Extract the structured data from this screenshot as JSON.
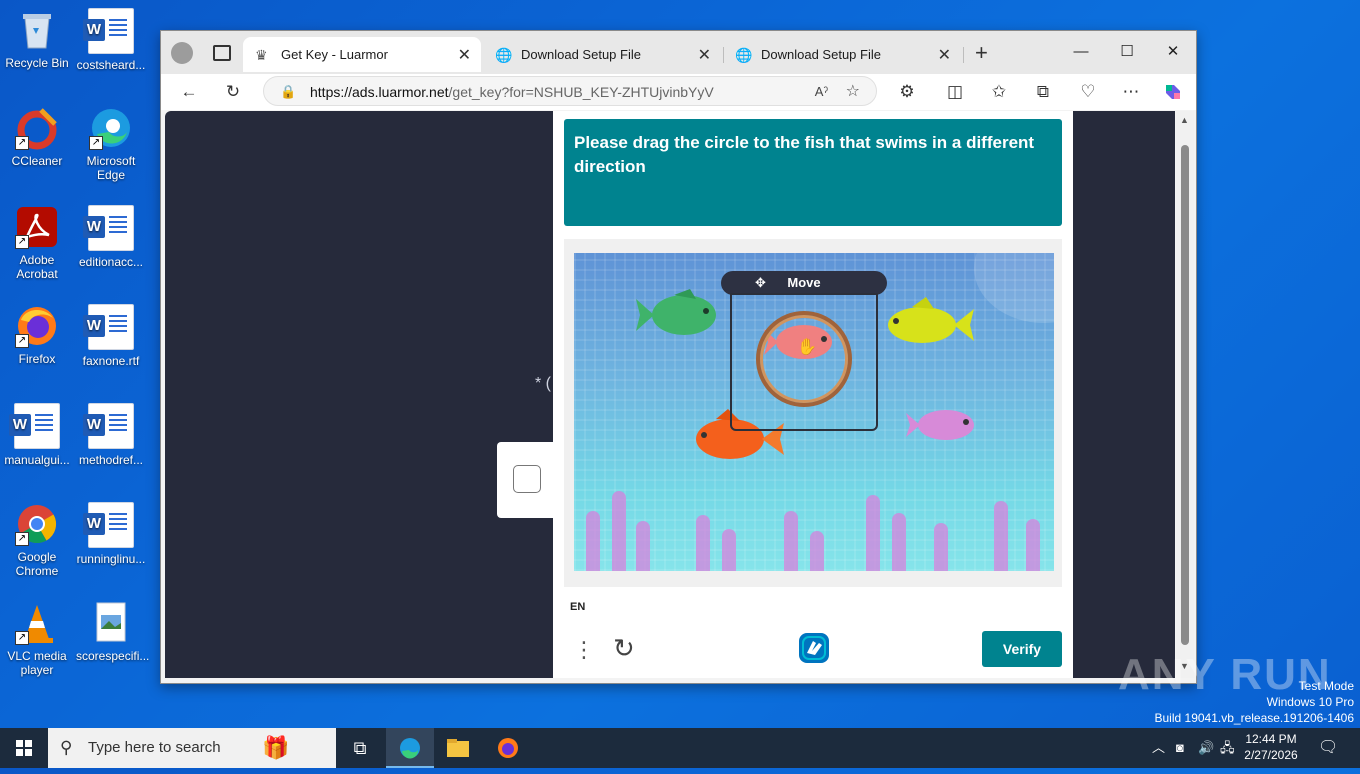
{
  "desktop": {
    "icons": [
      {
        "label": "Recycle Bin"
      },
      {
        "label": "costsheard..."
      },
      {
        "label": "CCleaner"
      },
      {
        "label": "Microsoft Edge"
      },
      {
        "label": "Adobe Acrobat"
      },
      {
        "label": "editionacc..."
      },
      {
        "label": "Firefox"
      },
      {
        "label": "faxnone.rtf"
      },
      {
        "label": "manualgui..."
      },
      {
        "label": "methodref..."
      },
      {
        "label": "Google Chrome"
      },
      {
        "label": "runninglinu..."
      },
      {
        "label": "VLC media player"
      },
      {
        "label": "scorespecifi..."
      }
    ]
  },
  "browser": {
    "tabs": [
      {
        "title": "Get Key - Luarmor",
        "active": true
      },
      {
        "title": "Download Setup File",
        "active": false
      },
      {
        "title": "Download Setup File",
        "active": false
      }
    ],
    "new_tab": "+",
    "window_controls": {
      "minimize": "—",
      "maximize": "☐",
      "close": "✕"
    },
    "address": {
      "host": "https://ads.luarmor.net",
      "path": "/get_key?for=NSHUB_KEY-ZHTUjvinbYyV"
    }
  },
  "page": {
    "peek_text": "* (",
    "captcha": {
      "prompt": "Please drag the circle to the fish that swims in a different direction",
      "move_label": "Move",
      "lang": "EN",
      "verify_label": "Verify"
    }
  },
  "watermark": {
    "brand": "ANY RUN",
    "line1": "Test Mode",
    "line2": "Windows 10 Pro",
    "line3": "Build 19041.vb_release.191206-1406"
  },
  "taskbar": {
    "search_placeholder": "Type here to search",
    "time": "12:44 PM",
    "date": "2/27/2026"
  },
  "colors": {
    "accent": "#00838f",
    "page_bg": "#262a3b"
  }
}
